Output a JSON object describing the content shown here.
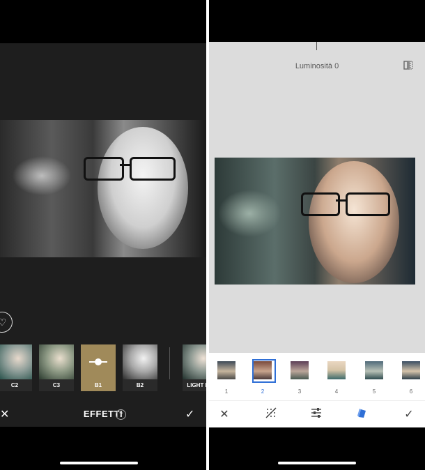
{
  "left_screen": {
    "toolbar": {
      "title": "EFFETTI",
      "help_label": "?",
      "close_label": "✕",
      "confirm_label": "✓"
    },
    "favorite_icon": "heart-icon",
    "filters": [
      {
        "label": "C2"
      },
      {
        "label": "C3"
      },
      {
        "label": "B1",
        "selected": true
      },
      {
        "label": "B2"
      },
      {
        "label": "LIGHT FO"
      }
    ],
    "accent_color": "#a08a5a"
  },
  "right_screen": {
    "header": {
      "brightness_label": "Luminosità 0"
    },
    "presets": [
      {
        "label": "1"
      },
      {
        "label": "2",
        "selected": true
      },
      {
        "label": "3"
      },
      {
        "label": "4"
      },
      {
        "label": "5"
      },
      {
        "label": "6"
      }
    ],
    "toolbar_icons": [
      "close-icon",
      "grain-icon",
      "sliders-icon",
      "style-icon",
      "check-icon"
    ],
    "accent_color": "#2f6fd6"
  }
}
